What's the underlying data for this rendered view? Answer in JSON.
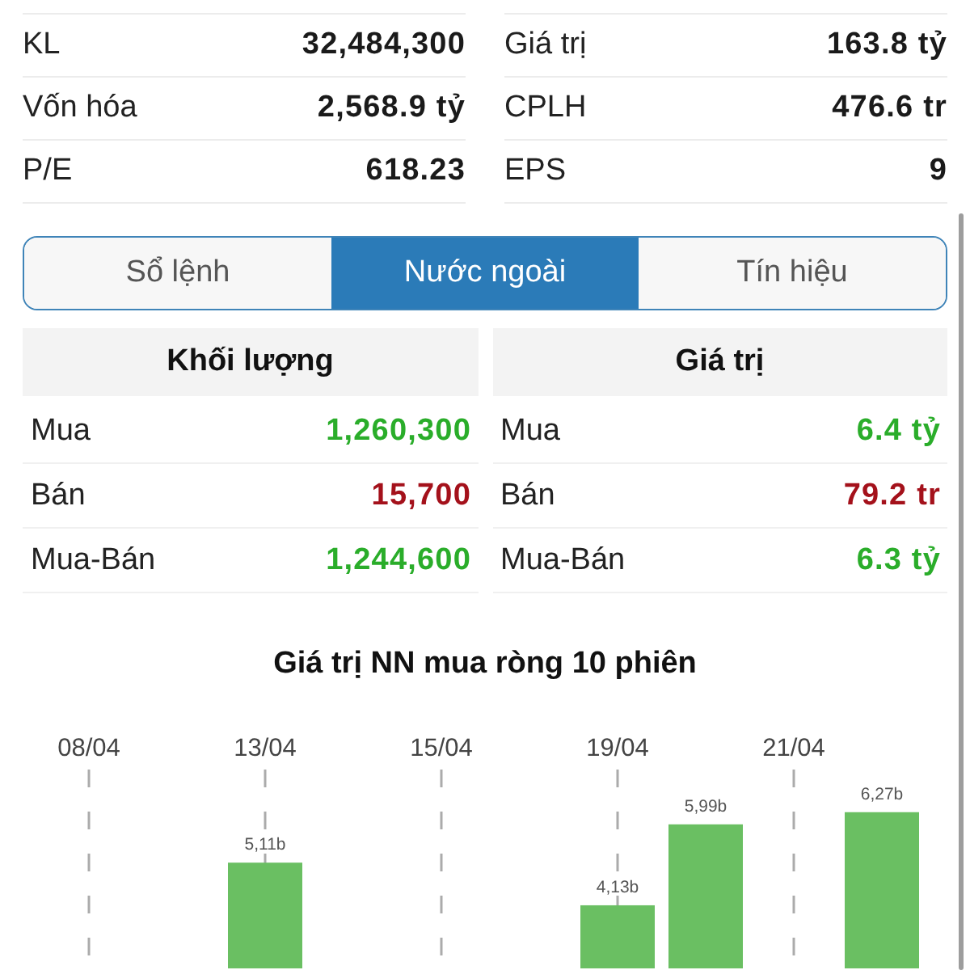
{
  "stats": [
    {
      "label": "KL",
      "value": "32,484,300"
    },
    {
      "label": "Giá trị",
      "value": "163.8 tỷ"
    },
    {
      "label": "Vốn hóa",
      "value": "2,568.9 tỷ"
    },
    {
      "label": "CPLH",
      "value": "476.6 tr"
    },
    {
      "label": "P/E",
      "value": "618.23"
    },
    {
      "label": "EPS",
      "value": "9"
    }
  ],
  "tabs": [
    {
      "label": "Sổ lệnh",
      "selected": false
    },
    {
      "label": "Nước ngoài",
      "selected": true
    },
    {
      "label": "Tín hiệu",
      "selected": false
    }
  ],
  "tables": [
    {
      "title": "Khối lượng",
      "rows": [
        {
          "label": "Mua",
          "value": "1,260,300",
          "color": "#2aad2a"
        },
        {
          "label": "Bán",
          "value": "15,700",
          "color": "#a4111b"
        },
        {
          "label": "Mua-Bán",
          "value": "1,244,600",
          "color": "#2aad2a"
        }
      ]
    },
    {
      "title": "Giá trị",
      "rows": [
        {
          "label": "Mua",
          "value": "6.4 tỷ",
          "color": "#2aad2a"
        },
        {
          "label": "Bán",
          "value": "79.2 tr",
          "color": "#a4111b"
        },
        {
          "label": "Mua-Bán",
          "value": "6.3 tỷ",
          "color": "#2aad2a"
        }
      ]
    }
  ],
  "chart": {
    "chart_data": {
      "type": "bar",
      "title": "Giá trị NN mua ròng 10 phiên",
      "categories": [
        "08/04",
        null,
        "13/04",
        null,
        "15/04",
        null,
        "19/04",
        null,
        "21/04",
        null
      ],
      "values": [
        null,
        null,
        5.11,
        null,
        null,
        null,
        4.13,
        5.99,
        null,
        6.27
      ],
      "value_labels": [
        null,
        null,
        "5,11b",
        null,
        null,
        null,
        "4,13b",
        "5,99b",
        null,
        "6,27b"
      ],
      "ylim": [
        2.68,
        7.25
      ],
      "grid": true
    }
  }
}
